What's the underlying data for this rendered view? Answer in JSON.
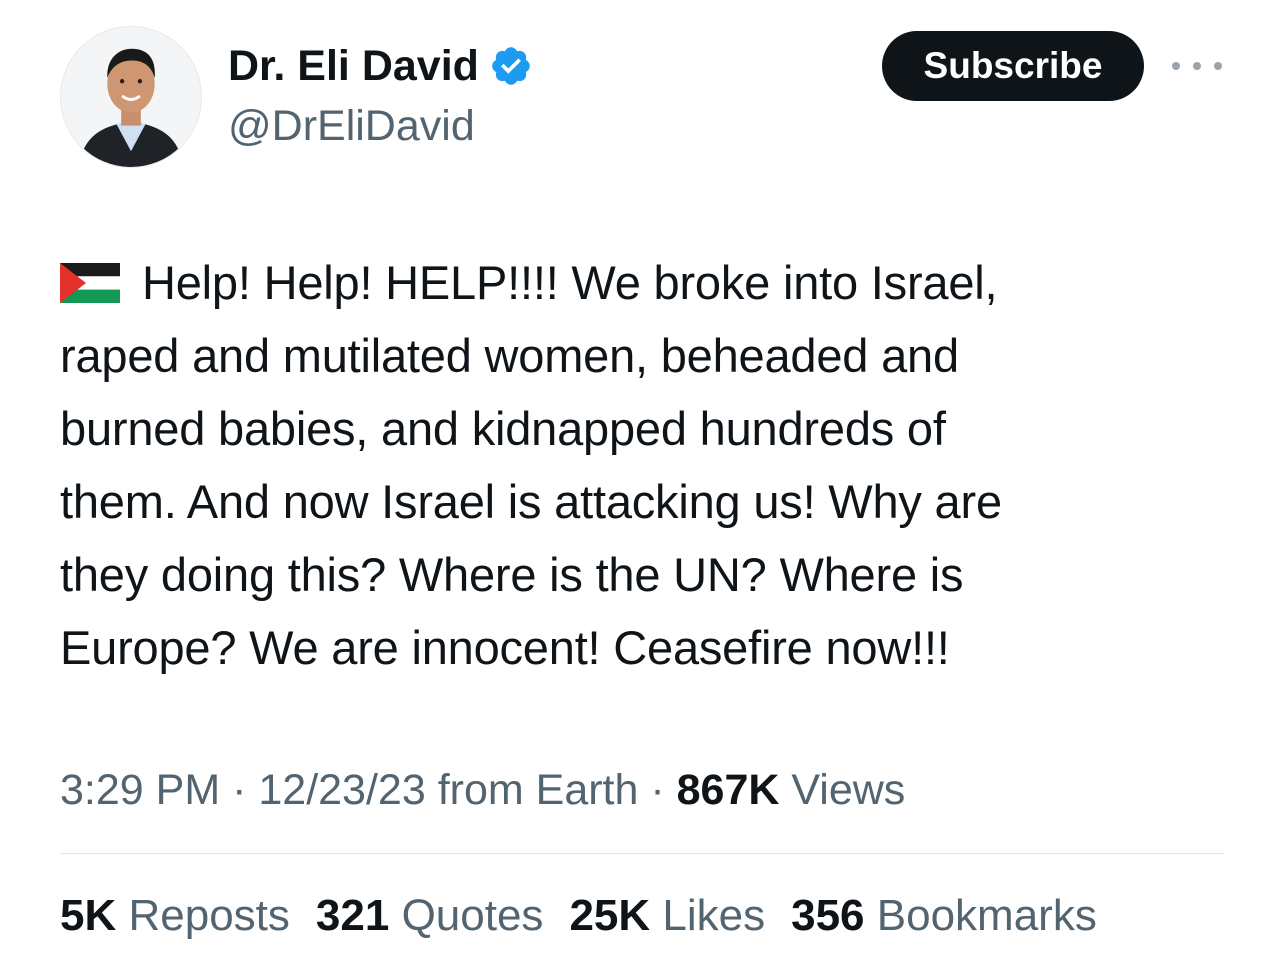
{
  "author": {
    "name": "Dr. Eli David",
    "handle": "@DrEliDavid",
    "verified": true,
    "verified_color": "#1d9bf0"
  },
  "actions": {
    "subscribe_label": "Subscribe",
    "more_icon": "more-horizontal-icon"
  },
  "tweet": {
    "flag_icon": "palestine-flag-icon",
    "lines": [
      "Help! Help! HELP!!!! We broke into Israel,",
      "raped and mutilated women, beheaded and",
      "burned babies, and kidnapped hundreds of",
      "them. And now Israel is attacking us! Why are",
      "they doing this? Where is the UN? Where is",
      "Europe? We are innocent! Ceasefire now!!!"
    ]
  },
  "meta": {
    "time": "3:29 PM",
    "sep1": " · ",
    "date": "12/23/23",
    "source": " from Earth",
    "sep2": " · ",
    "views_count": "867K",
    "views_label": " Views"
  },
  "stats": {
    "reposts_count": "5K",
    "reposts_label": "Reposts",
    "quotes_count": "321",
    "quotes_label": "Quotes",
    "likes_count": "25K",
    "likes_label": "Likes",
    "bookmarks_count": "356",
    "bookmarks_label": "Bookmarks"
  },
  "colors": {
    "text": "#0f1419",
    "muted": "#536471",
    "button_bg": "#0f1419",
    "button_text": "#ffffff"
  }
}
